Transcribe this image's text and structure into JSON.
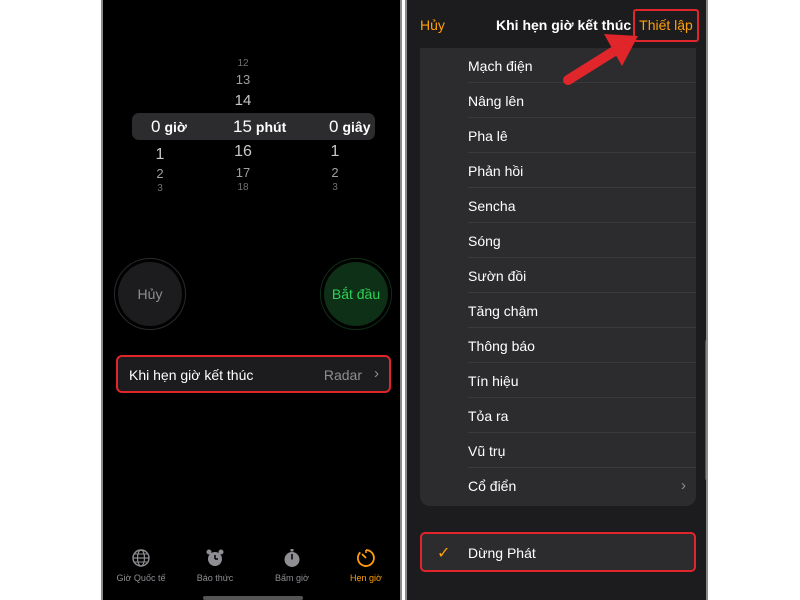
{
  "picker": {
    "hours": {
      "above": [
        "",
        "",
        ""
      ],
      "selected": "0",
      "unit": "giờ",
      "below": [
        "1",
        "2",
        "3"
      ]
    },
    "minutes": {
      "above": [
        "12",
        "13",
        "14"
      ],
      "selected": "15",
      "unit": "phút",
      "below": [
        "16",
        "17",
        "18"
      ]
    },
    "seconds": {
      "above": [
        "",
        "",
        ""
      ],
      "selected": "0",
      "unit": "giây",
      "below": [
        "1",
        "2",
        "3"
      ]
    }
  },
  "buttons": {
    "cancel": "Hủy",
    "start": "Bắt đầu"
  },
  "timer_end_row": {
    "label": "Khi hẹn giờ kết thúc",
    "value": "Radar"
  },
  "tabs": [
    {
      "label": "Giờ Quốc tế",
      "icon": "globe-icon"
    },
    {
      "label": "Báo thức",
      "icon": "alarm-icon"
    },
    {
      "label": "Bấm giờ",
      "icon": "stopwatch-icon"
    },
    {
      "label": "Hẹn giờ",
      "icon": "timer-icon",
      "active": true
    }
  ],
  "sheet": {
    "cancel": "Hủy",
    "title": "Khi hẹn giờ kết thúc",
    "set": "Thiết lập",
    "sounds": [
      "Mạch điện",
      "Nâng lên",
      "Pha lê",
      "Phản hồi",
      "Sencha",
      "Sóng",
      "Sườn đồi",
      "Tăng chậm",
      "Thông báo",
      "Tín hiệu",
      "Tỏa ra",
      "Vũ trụ",
      "Cổ điển"
    ],
    "stop": "Dừng Phát"
  },
  "colors": {
    "accent": "#ff9f0a",
    "start_green": "#30d158",
    "highlight_red": "#e0252b"
  }
}
